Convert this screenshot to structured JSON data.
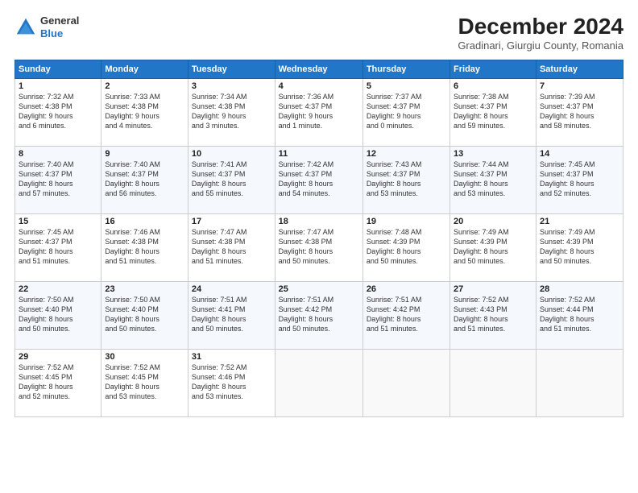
{
  "header": {
    "logo_line1": "General",
    "logo_line2": "Blue",
    "title": "December 2024",
    "subtitle": "Gradinari, Giurgiu County, Romania"
  },
  "calendar": {
    "weekdays": [
      "Sunday",
      "Monday",
      "Tuesday",
      "Wednesday",
      "Thursday",
      "Friday",
      "Saturday"
    ],
    "rows": [
      [
        {
          "day": "1",
          "detail": "Sunrise: 7:32 AM\nSunset: 4:38 PM\nDaylight: 9 hours\nand 6 minutes."
        },
        {
          "day": "2",
          "detail": "Sunrise: 7:33 AM\nSunset: 4:38 PM\nDaylight: 9 hours\nand 4 minutes."
        },
        {
          "day": "3",
          "detail": "Sunrise: 7:34 AM\nSunset: 4:38 PM\nDaylight: 9 hours\nand 3 minutes."
        },
        {
          "day": "4",
          "detail": "Sunrise: 7:36 AM\nSunset: 4:37 PM\nDaylight: 9 hours\nand 1 minute."
        },
        {
          "day": "5",
          "detail": "Sunrise: 7:37 AM\nSunset: 4:37 PM\nDaylight: 9 hours\nand 0 minutes."
        },
        {
          "day": "6",
          "detail": "Sunrise: 7:38 AM\nSunset: 4:37 PM\nDaylight: 8 hours\nand 59 minutes."
        },
        {
          "day": "7",
          "detail": "Sunrise: 7:39 AM\nSunset: 4:37 PM\nDaylight: 8 hours\nand 58 minutes."
        }
      ],
      [
        {
          "day": "8",
          "detail": "Sunrise: 7:40 AM\nSunset: 4:37 PM\nDaylight: 8 hours\nand 57 minutes."
        },
        {
          "day": "9",
          "detail": "Sunrise: 7:40 AM\nSunset: 4:37 PM\nDaylight: 8 hours\nand 56 minutes."
        },
        {
          "day": "10",
          "detail": "Sunrise: 7:41 AM\nSunset: 4:37 PM\nDaylight: 8 hours\nand 55 minutes."
        },
        {
          "day": "11",
          "detail": "Sunrise: 7:42 AM\nSunset: 4:37 PM\nDaylight: 8 hours\nand 54 minutes."
        },
        {
          "day": "12",
          "detail": "Sunrise: 7:43 AM\nSunset: 4:37 PM\nDaylight: 8 hours\nand 53 minutes."
        },
        {
          "day": "13",
          "detail": "Sunrise: 7:44 AM\nSunset: 4:37 PM\nDaylight: 8 hours\nand 53 minutes."
        },
        {
          "day": "14",
          "detail": "Sunrise: 7:45 AM\nSunset: 4:37 PM\nDaylight: 8 hours\nand 52 minutes."
        }
      ],
      [
        {
          "day": "15",
          "detail": "Sunrise: 7:45 AM\nSunset: 4:37 PM\nDaylight: 8 hours\nand 51 minutes."
        },
        {
          "day": "16",
          "detail": "Sunrise: 7:46 AM\nSunset: 4:38 PM\nDaylight: 8 hours\nand 51 minutes."
        },
        {
          "day": "17",
          "detail": "Sunrise: 7:47 AM\nSunset: 4:38 PM\nDaylight: 8 hours\nand 51 minutes."
        },
        {
          "day": "18",
          "detail": "Sunrise: 7:47 AM\nSunset: 4:38 PM\nDaylight: 8 hours\nand 50 minutes."
        },
        {
          "day": "19",
          "detail": "Sunrise: 7:48 AM\nSunset: 4:39 PM\nDaylight: 8 hours\nand 50 minutes."
        },
        {
          "day": "20",
          "detail": "Sunrise: 7:49 AM\nSunset: 4:39 PM\nDaylight: 8 hours\nand 50 minutes."
        },
        {
          "day": "21",
          "detail": "Sunrise: 7:49 AM\nSunset: 4:39 PM\nDaylight: 8 hours\nand 50 minutes."
        }
      ],
      [
        {
          "day": "22",
          "detail": "Sunrise: 7:50 AM\nSunset: 4:40 PM\nDaylight: 8 hours\nand 50 minutes."
        },
        {
          "day": "23",
          "detail": "Sunrise: 7:50 AM\nSunset: 4:40 PM\nDaylight: 8 hours\nand 50 minutes."
        },
        {
          "day": "24",
          "detail": "Sunrise: 7:51 AM\nSunset: 4:41 PM\nDaylight: 8 hours\nand 50 minutes."
        },
        {
          "day": "25",
          "detail": "Sunrise: 7:51 AM\nSunset: 4:42 PM\nDaylight: 8 hours\nand 50 minutes."
        },
        {
          "day": "26",
          "detail": "Sunrise: 7:51 AM\nSunset: 4:42 PM\nDaylight: 8 hours\nand 51 minutes."
        },
        {
          "day": "27",
          "detail": "Sunrise: 7:52 AM\nSunset: 4:43 PM\nDaylight: 8 hours\nand 51 minutes."
        },
        {
          "day": "28",
          "detail": "Sunrise: 7:52 AM\nSunset: 4:44 PM\nDaylight: 8 hours\nand 51 minutes."
        }
      ],
      [
        {
          "day": "29",
          "detail": "Sunrise: 7:52 AM\nSunset: 4:45 PM\nDaylight: 8 hours\nand 52 minutes."
        },
        {
          "day": "30",
          "detail": "Sunrise: 7:52 AM\nSunset: 4:45 PM\nDaylight: 8 hours\nand 53 minutes."
        },
        {
          "day": "31",
          "detail": "Sunrise: 7:52 AM\nSunset: 4:46 PM\nDaylight: 8 hours\nand 53 minutes."
        },
        {
          "day": "",
          "detail": ""
        },
        {
          "day": "",
          "detail": ""
        },
        {
          "day": "",
          "detail": ""
        },
        {
          "day": "",
          "detail": ""
        }
      ]
    ]
  }
}
